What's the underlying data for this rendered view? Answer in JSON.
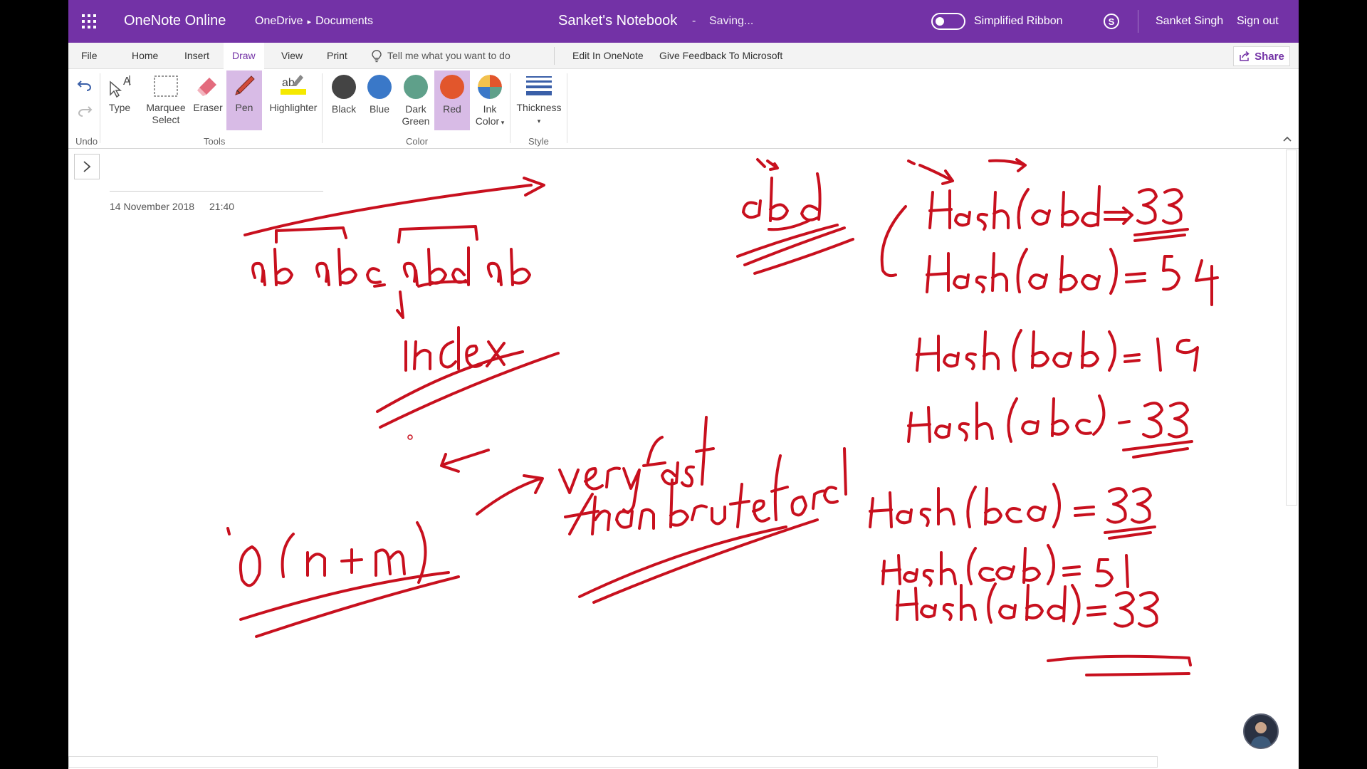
{
  "titlebar": {
    "app_name": "OneNote Online",
    "breadcrumb": [
      "OneDrive",
      "Documents"
    ],
    "notebook_title": "Sanket's Notebook",
    "separator": "-",
    "status": "Saving...",
    "simplified_ribbon_label": "Simplified Ribbon",
    "user_name": "Sanket Singh",
    "sign_out": "Sign out",
    "accent": "#7332a6"
  },
  "tabs": {
    "items": [
      "File",
      "Home",
      "Insert",
      "Draw",
      "View",
      "Print"
    ],
    "active": "Draw",
    "tell_me": "Tell me what you want to do",
    "edit_in_onenote": "Edit In OneNote",
    "feedback": "Give Feedback To Microsoft",
    "share": "Share"
  },
  "ribbon": {
    "undo_label": "Undo",
    "tools": {
      "label": "Tools",
      "type": "Type",
      "marquee_1": "Marquee",
      "marquee_2": "Select",
      "eraser": "Eraser",
      "pen": "Pen",
      "highlighter": "Highlighter"
    },
    "color": {
      "label": "Color",
      "black": "Black",
      "blue": "Blue",
      "dark_green_1": "Dark",
      "dark_green_2": "Green",
      "red": "Red",
      "ink_1": "Ink",
      "ink_2": "Color",
      "swatches": {
        "black": "#444444",
        "blue": "#3a78c8",
        "dark_green": "#5fa08a",
        "red": "#e2562c"
      },
      "selected": "Red"
    },
    "style": {
      "label": "Style",
      "thickness": "Thickness"
    }
  },
  "page": {
    "date": "14 November 2018",
    "time": "21:40",
    "ink_color": "#c8101e"
  }
}
